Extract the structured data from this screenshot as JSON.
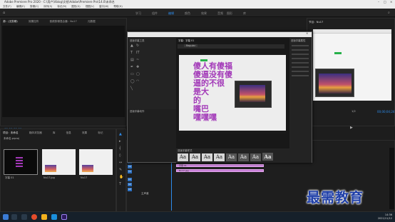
{
  "window": {
    "title": "Adobe Premiere Pro 2020 - C:\\用户\\Vblog\\文档\\Adobe\\Premiere Pro\\14.0\\未命名"
  },
  "menu": [
    "文件(F)",
    "编辑(E)",
    "剪辑(C)",
    "序列(S)",
    "标记(M)",
    "图形(G)",
    "视图(V)",
    "窗口(W)",
    "帮助(H)"
  ],
  "workspaces": [
    "学习",
    "组件",
    "编辑",
    "颜色",
    "效果",
    "音频",
    "图形",
    "库"
  ],
  "source_panel": {
    "tabs": [
      "源：(无剪辑)",
      "效果控件",
      "音频剪辑混合器：Nu17",
      "元数据"
    ],
    "timecode": "00;00;00;00"
  },
  "program_panel": {
    "tab": "节目：Nu17",
    "timecode": "00;00;04;24",
    "fit_label": "1/2"
  },
  "project_panel": {
    "tabs": [
      "项目：未命名",
      "媒体浏览器",
      "库",
      "信息",
      "效果",
      "标记"
    ],
    "project_file": "未命名.prproj",
    "items": [
      "字幕 01",
      "Nu17.jpg",
      "Nu17"
    ]
  },
  "timeline_panel": {
    "tab": "Nu17",
    "timecode": "00;00;00;00",
    "tracks_v": [
      "V3",
      "V2",
      "V1"
    ],
    "tracks_a": [
      "A1",
      "A2",
      "A3"
    ],
    "master": "主声道",
    "clips": [
      "字幕 01",
      "Nu17.jpg"
    ]
  },
  "titler": {
    "title": "字幕：字幕 01",
    "font_value": "Regular",
    "caption_lines": [
      "傻人有傻福",
      "傻逼没有傻",
      "逼的不很",
      "是大",
      "的",
      "嘴巴",
      "嘿嘿嘿"
    ],
    "styles_tab": "旧版字幕样式",
    "style_samples": [
      "Aa",
      "Aa",
      "Aa",
      "Aa",
      "Aa",
      "Aa",
      "Aa",
      "Aa"
    ],
    "properties_tab": "旧版字幕属性",
    "tools_tab": "旧版字幕工具",
    "actions_tab": "旧版字幕动作"
  },
  "watermark": "最需教育",
  "clock": {
    "time": "14:36",
    "date": "2021/11/12"
  },
  "colors": {
    "accent": "#2d8ceb",
    "caption": "#a238b8",
    "clip": "#c77fd6",
    "watermark": "#1f3fa8"
  }
}
